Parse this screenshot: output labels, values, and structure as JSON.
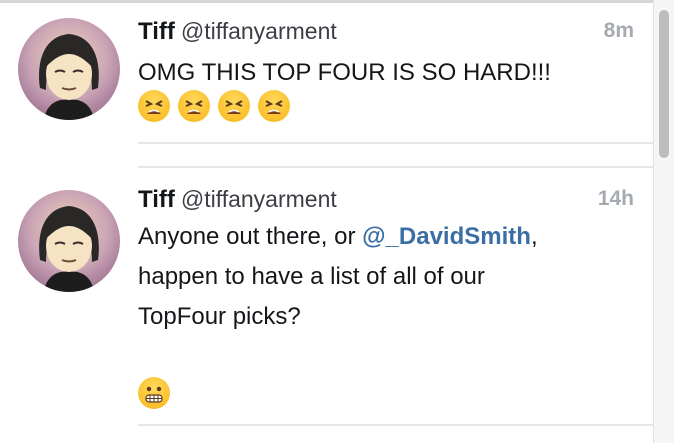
{
  "tweets": [
    {
      "name": "Tiff",
      "handle": "@tiffanyarment",
      "time": "8m",
      "text": "OMG THIS TOP FOUR IS SO HARD!!!",
      "emojis": [
        "tired-face",
        "tired-face",
        "tired-face",
        "tired-face"
      ]
    },
    {
      "name": "Tiff",
      "handle": "@tiffanyarment",
      "time": "14h",
      "text_before": "Anyone out there, or ",
      "mention": "@_DavidSmith",
      "text_after": ",",
      "line2": "happen to have a list of all of our",
      "line3": "TopFour picks?",
      "emojis": [
        "grimacing-face"
      ]
    }
  ],
  "colors": {
    "mention": "#3b6ea5",
    "timestamp": "#a4aab0",
    "separator": "#e4e6e8",
    "emoji_yellow": "#fbc02d"
  }
}
